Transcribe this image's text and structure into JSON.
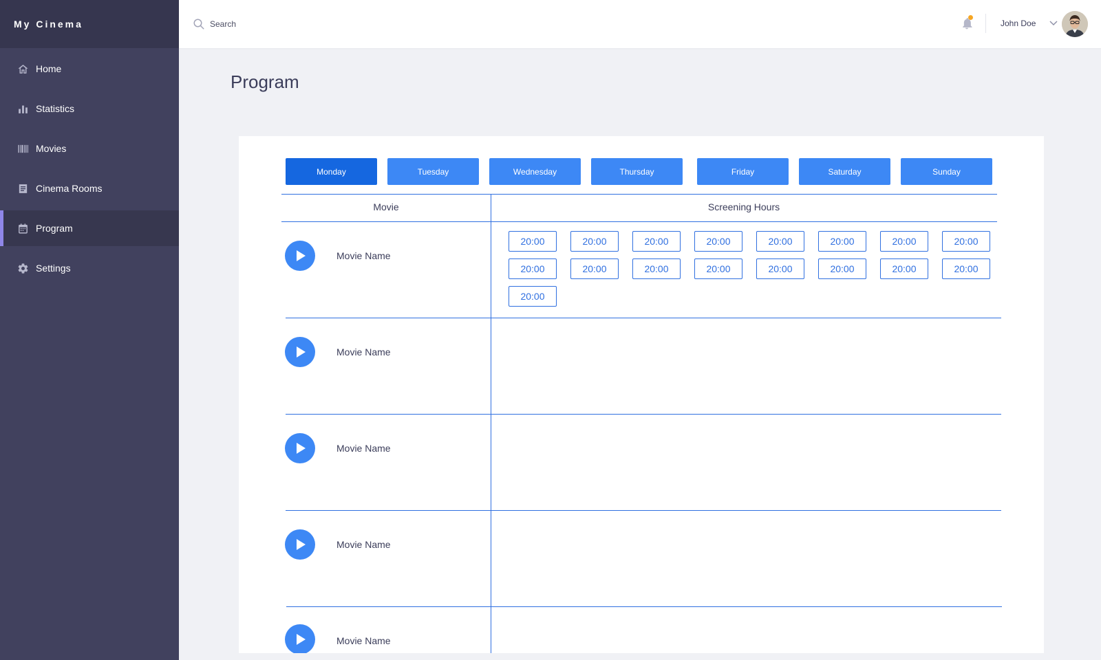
{
  "app": {
    "brand": "My Cinema"
  },
  "sidebar": {
    "items": [
      {
        "label": "Home",
        "icon": "home-icon"
      },
      {
        "label": "Statistics",
        "icon": "bar-chart-icon"
      },
      {
        "label": "Movies",
        "icon": "barcode-icon"
      },
      {
        "label": "Cinema Rooms",
        "icon": "document-icon"
      },
      {
        "label": "Program",
        "icon": "calendar-icon",
        "active": true
      },
      {
        "label": "Settings",
        "icon": "gear-icon"
      }
    ]
  },
  "header": {
    "search_placeholder": "Search",
    "user_name": "John Doe",
    "notification_dot_color": "#f6a623"
  },
  "page": {
    "title": "Program"
  },
  "days": [
    "Monday",
    "Tuesday",
    "Wednesday",
    "Thursday",
    "Friday",
    "Saturday",
    "Sunday"
  ],
  "active_day": "Monday",
  "table": {
    "headers": {
      "movie": "Movie",
      "hours": "Screening Hours"
    },
    "rows": [
      {
        "movie": "Movie Name",
        "times": [
          "20:00",
          "20:00",
          "20:00",
          "20:00",
          "20:00",
          "20:00",
          "20:00",
          "20:00",
          "20:00",
          "20:00",
          "20:00",
          "20:00",
          "20:00",
          "20:00",
          "20:00",
          "20:00",
          "20:00"
        ]
      },
      {
        "movie": "Movie Name",
        "times": []
      },
      {
        "movie": "Movie Name",
        "times": []
      },
      {
        "movie": "Movie Name",
        "times": []
      },
      {
        "movie": "Movie Name",
        "times": []
      }
    ]
  },
  "colors": {
    "sidebar_bg": "#41415e",
    "brand_bg": "#36364f",
    "accent": "#3d88f5",
    "active_day": "#1567e0",
    "active_indicator": "#8f86e8",
    "line": "#2f6fe0"
  }
}
